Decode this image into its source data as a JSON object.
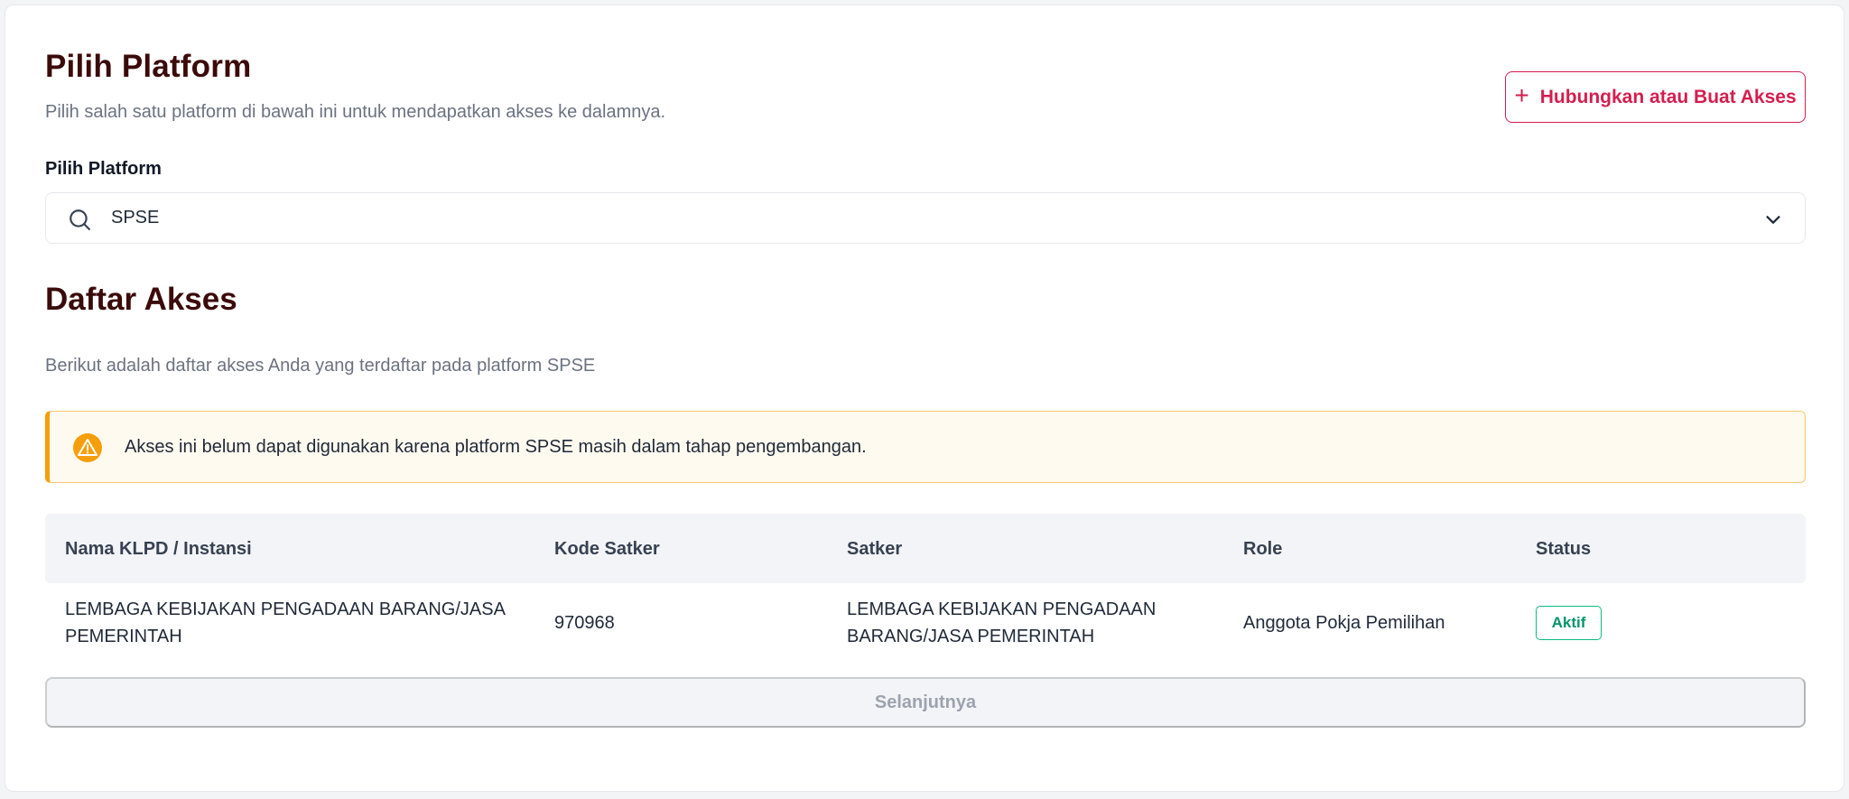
{
  "header": {
    "title": "Pilih Platform",
    "subtitle": "Pilih salah satu platform di bawah ini untuk mendapatkan akses ke dalamnya.",
    "connect_button_label": "Hubungkan atau Buat Akses"
  },
  "platform_select": {
    "label": "Pilih Platform",
    "value": "SPSE"
  },
  "access_section": {
    "title": "Daftar Akses",
    "description": "Berikut adalah daftar akses Anda yang terdaftar pada platform SPSE",
    "alert_text": "Akses ini belum dapat digunakan karena platform SPSE masih dalam tahap pengembangan."
  },
  "table": {
    "columns": [
      "Nama KLPD / Instansi",
      "Kode Satker",
      "Satker",
      "Role",
      "Status"
    ],
    "rows": [
      {
        "instansi_line1": "LEMBAGA KEBIJAKAN PENGADAAN BARANG/JASA",
        "instansi_line2": "PEMERINTAH",
        "kode_satker": "970968",
        "satker_line1": "LEMBAGA KEBIJAKAN PENGADAAN",
        "satker_line2": "BARANG/JASA PEMERINTAH",
        "role": "Anggota Pokja Pemilihan",
        "status": "Aktif"
      }
    ]
  },
  "footer": {
    "next_button_label": "Selanjutnya"
  },
  "colors": {
    "title": "#3b0a0a",
    "accent": "#d41e4f",
    "warning": "#f59e0b",
    "success": "#10b981"
  },
  "icons": [
    "plus-icon",
    "search-icon",
    "chevron-down-icon",
    "warning-icon"
  ]
}
